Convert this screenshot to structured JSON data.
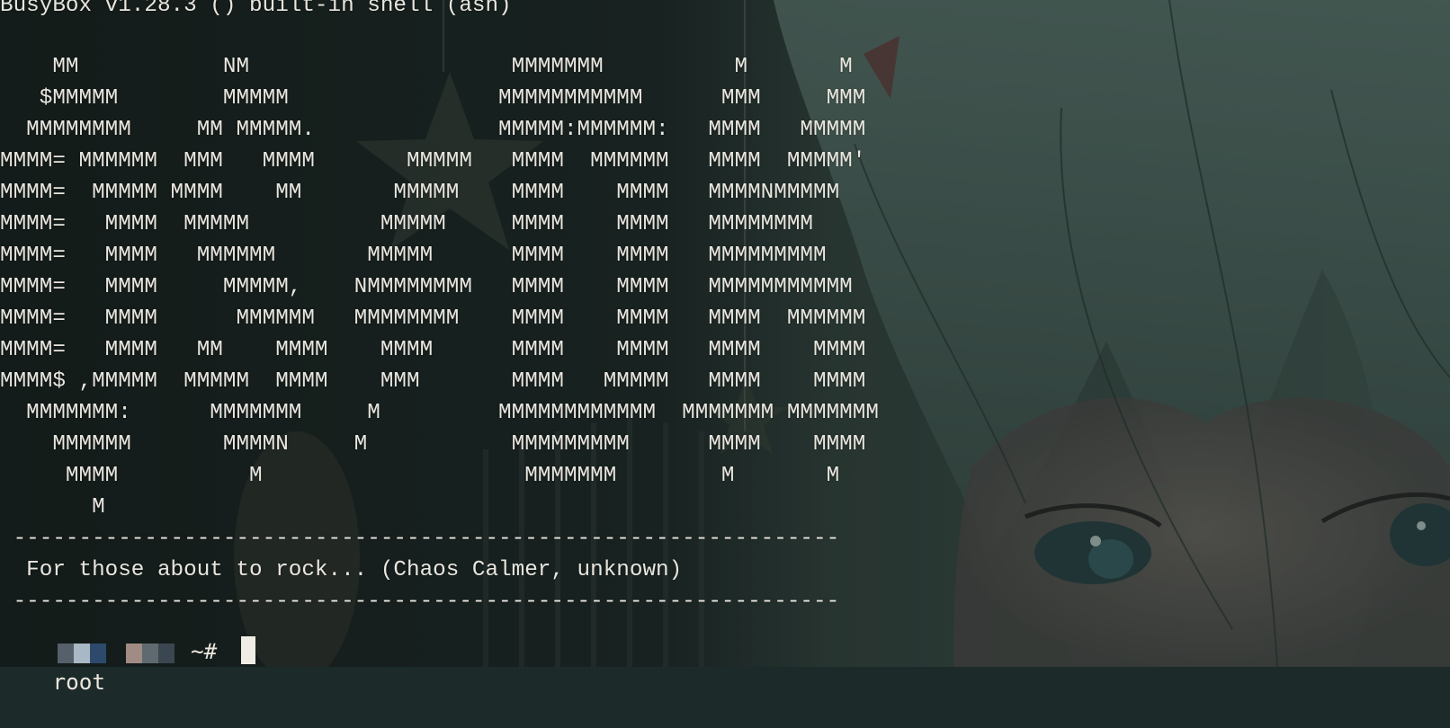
{
  "terminal": {
    "lines": [
      "BusyBox v1.28.3 () built-in shell (ash)",
      "",
      "    MM           NM                    MMMMMMM          M       M",
      "   $MMMMM        MMMMM                MMMMMMMMMMM      MMM     MMM",
      "  MMMMMMMM     MM MMMMM.              MMMMM:MMMMMM:   MMMM   MMMMM",
      "MMMM= MMMMMM  MMM   MMMM       MMMMM   MMMM  MMMMMM   MMMM  MMMMM'",
      "MMMM=  MMMMM MMMM    MM       MMMMM    MMMM    MMMM   MMMMNMMMMM",
      "MMMM=   MMMM  MMMMM          MMMMM     MMMM    MMMM   MMMMMMMM",
      "MMMM=   MMMM   MMMMMM       MMMMM      MMMM    MMMM   MMMMMMMMM",
      "MMMM=   MMMM     MMMMM,    NMMMMMMMM   MMMM    MMMM   MMMMMMMMMMM",
      "MMMM=   MMMM      MMMMMM   MMMMMMMM    MMMM    MMMM   MMMM  MMMMMM",
      "MMMM=   MMMM   MM    MMMM    MMMM      MMMM    MMMM   MMMM    MMMM",
      "MMMM$ ,MMMMM  MMMMM  MMMM    MMM       MMMM   MMMMM   MMMM    MMMM",
      "  MMMMMMM:      MMMMMMM     M         MMMMMMMMMMMM  MMMMMMM MMMMMMM",
      "    MMMMMM       MMMMN     M           MMMMMMMMM      MMMM    MMMM",
      "     MMMM          M                    MMMMMMM        M       M",
      "       M",
      " ---------------------------------------------------------------",
      "  For those about to rock... (Chaos Calmer, unknown)",
      " ---------------------------------------------------------------"
    ],
    "prompt": {
      "user": "root",
      "suffix": "~#"
    }
  },
  "colors": {
    "text": "#e9e6df",
    "background": "#1c2a2a",
    "hair": "#6c8a80"
  }
}
